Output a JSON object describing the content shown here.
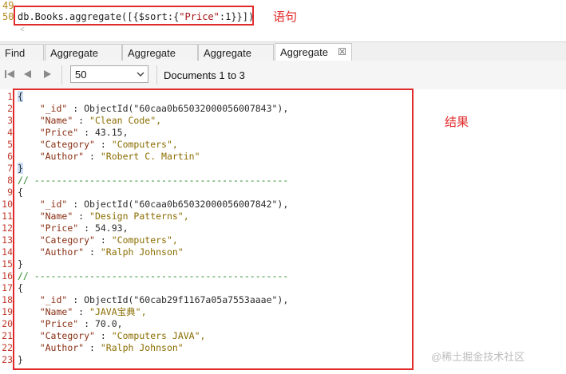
{
  "editor": {
    "line_numbers": [
      "49",
      "50"
    ],
    "query_parts": [
      "db.Books.aggregate([{$sort:{",
      "\"Price\"",
      ":1}}])"
    ],
    "annotation": "语句"
  },
  "tabs": [
    {
      "label": "Find"
    },
    {
      "label": "Aggregate"
    },
    {
      "label": "Aggregate"
    },
    {
      "label": "Aggregate"
    },
    {
      "label": "Aggregate",
      "active": true,
      "close": "☒"
    }
  ],
  "toolbar": {
    "page_size": "50",
    "doc_range": "Documents 1 to 3"
  },
  "results": {
    "annotation": "结果",
    "separator": "// ----------------------------------------------",
    "documents": [
      {
        "_id_label": "\"_id\"",
        "_id_value": "ObjectId(\"60caa0b65032000056007843\"),",
        "name": "\"Clean Code\",",
        "price": "43.15,",
        "category": "\"Computers\",",
        "author": "\"Robert C. Martin\""
      },
      {
        "_id_label": "\"_id\"",
        "_id_value": "ObjectId(\"60caa0b65032000056007842\"),",
        "name": "\"Design Patterns\",",
        "price": "54.93,",
        "category": "\"Computers\",",
        "author": "\"Ralph Johnson\""
      },
      {
        "_id_label": "\"_id\"",
        "_id_value": "ObjectId(\"60cab29f1167a05a7553aaae\"),",
        "name": "\"JAVA宝典\",",
        "price": "70.0,",
        "category": "\"Computers JAVA\",",
        "author": "\"Ralph Johnson\""
      }
    ],
    "keys": {
      "name": "\"Name\"",
      "price": "\"Price\"",
      "category": "\"Category\"",
      "author": "\"Author\""
    },
    "line_numbers": [
      "1",
      "2",
      "3",
      "4",
      "5",
      "6",
      "7",
      "8",
      "9",
      "10",
      "11",
      "12",
      "13",
      "14",
      "15",
      "16",
      "17",
      "18",
      "19",
      "20",
      "21",
      "22",
      "23"
    ]
  },
  "watermark": "@稀土掘金技术社区",
  "colors": {
    "annotation_red": "#e12a2a",
    "line_number": "#c0392b",
    "string": "#8b6d00"
  }
}
